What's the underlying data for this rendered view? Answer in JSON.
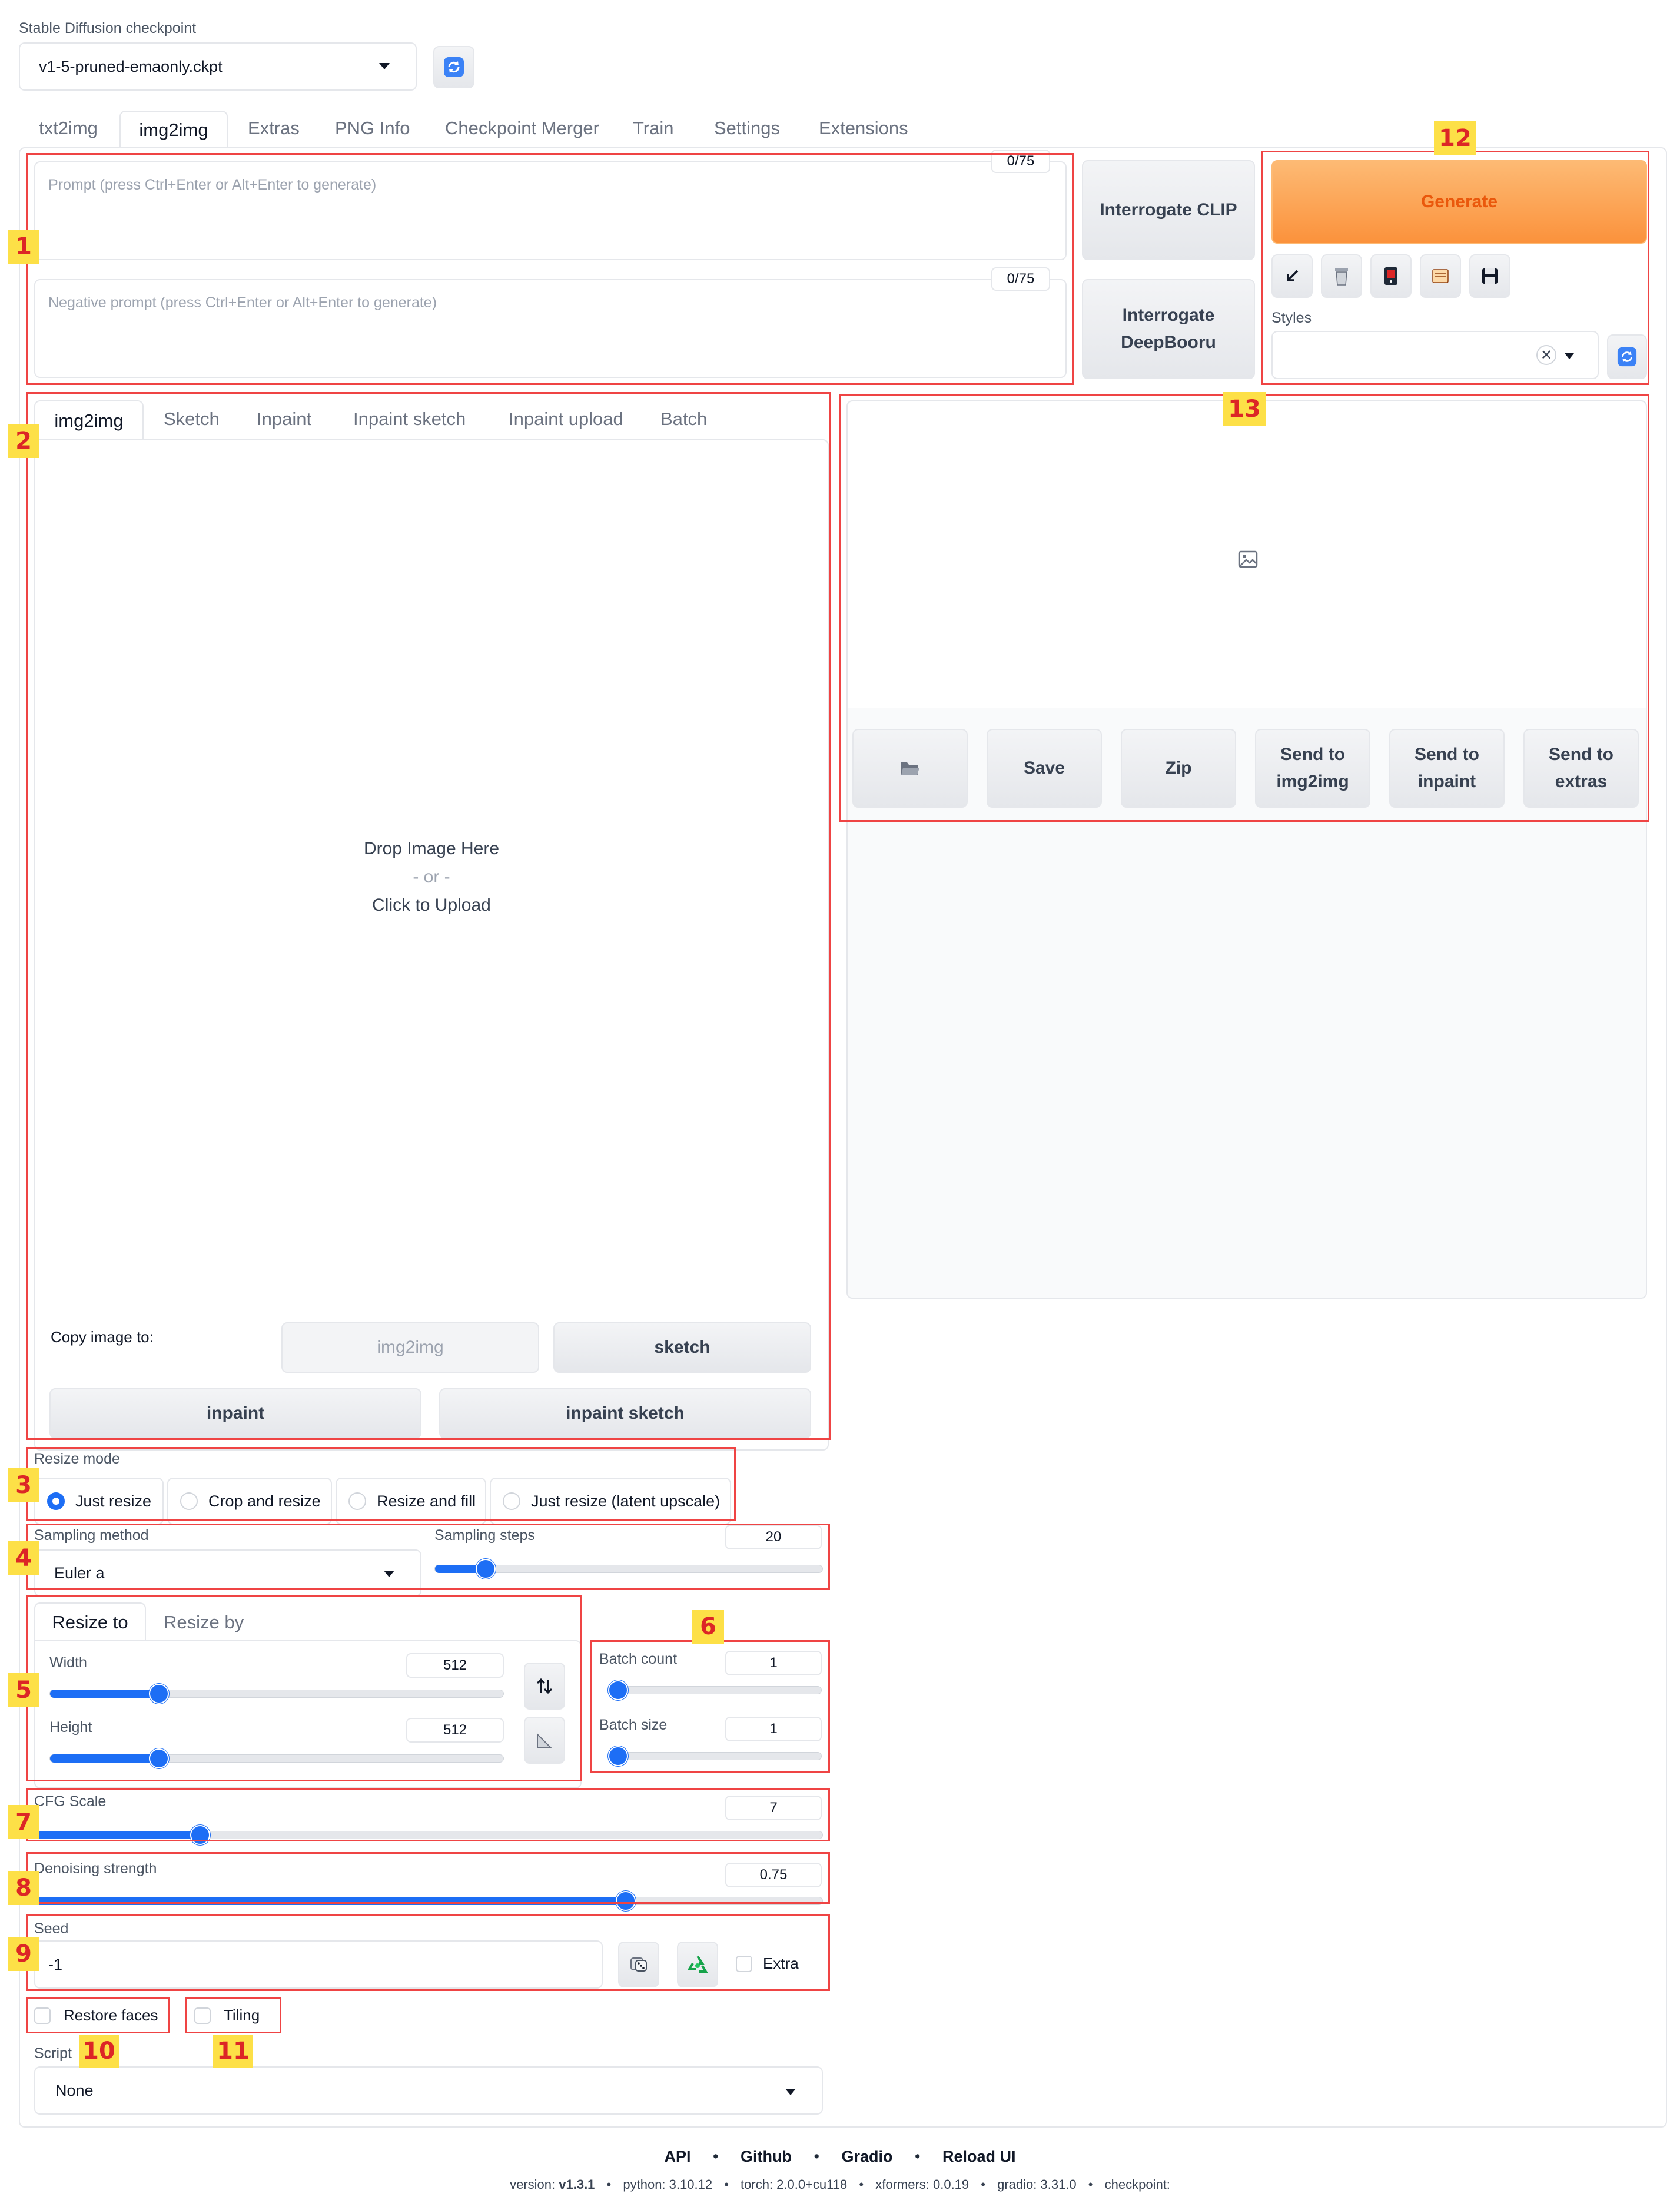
{
  "checkpoint": {
    "label": "Stable Diffusion checkpoint",
    "value": "v1-5-pruned-emaonly.ckpt"
  },
  "tabs": [
    "txt2img",
    "img2img",
    "Extras",
    "PNG Info",
    "Checkpoint Merger",
    "Train",
    "Settings",
    "Extensions"
  ],
  "active_tab": "img2img",
  "prompt": {
    "placeholder": "Prompt (press Ctrl+Enter or Alt+Enter to generate)",
    "counter": "0/75"
  },
  "negative_prompt": {
    "placeholder": "Negative prompt (press Ctrl+Enter or Alt+Enter to generate)",
    "counter": "0/75"
  },
  "interrogate": {
    "clip": "Interrogate CLIP",
    "deepbooru": "Interrogate DeepBooru"
  },
  "generate_label": "Generate",
  "styles_label": "Styles",
  "tool_icons": [
    "arrow-down-left-icon",
    "trash-icon",
    "red-card-icon",
    "clipboard-icon",
    "save-disk-icon"
  ],
  "subtabs": [
    "img2img",
    "Sketch",
    "Inpaint",
    "Inpaint sketch",
    "Inpaint upload",
    "Batch"
  ],
  "upload": {
    "line1": "Drop Image Here",
    "line2": "- or -",
    "line3": "Click to Upload"
  },
  "copy_image": {
    "label": "Copy image to:",
    "img2img": "img2img",
    "sketch": "sketch",
    "inpaint": "inpaint",
    "inpaint_sketch": "inpaint sketch"
  },
  "output_buttons": {
    "folder_icon": "folder-icon",
    "save": "Save",
    "zip": "Zip",
    "send_img2img": "Send to img2img",
    "send_inpaint": "Send to inpaint",
    "send_extras": "Send to extras"
  },
  "resize_mode": {
    "label": "Resize mode",
    "options": [
      "Just resize",
      "Crop and resize",
      "Resize and fill",
      "Just resize (latent upscale)"
    ],
    "selected": "Just resize"
  },
  "sampling": {
    "method_label": "Sampling method",
    "method": "Euler a",
    "steps_label": "Sampling steps",
    "steps": "20",
    "steps_fraction": 0.13
  },
  "resize_tabs": [
    "Resize to",
    "Resize by"
  ],
  "width": {
    "label": "Width",
    "value": "512",
    "fraction": 0.24
  },
  "height": {
    "label": "Height",
    "value": "512",
    "fraction": 0.24
  },
  "batch_count": {
    "label": "Batch count",
    "value": "1",
    "fraction": 0.0
  },
  "batch_size": {
    "label": "Batch size",
    "value": "1",
    "fraction": 0.0
  },
  "cfg": {
    "label": "CFG Scale",
    "value": "7",
    "fraction": 0.21
  },
  "denoising": {
    "label": "Denoising strength",
    "value": "0.75",
    "fraction": 0.75
  },
  "seed": {
    "label": "Seed",
    "value": "-1",
    "extra": "Extra"
  },
  "restore_faces": "Restore faces",
  "tiling": "Tiling",
  "script": {
    "label": "Script",
    "value": "None"
  },
  "badges": [
    "1",
    "2",
    "3",
    "4",
    "5",
    "6",
    "7",
    "8",
    "9",
    "10",
    "11",
    "12",
    "13"
  ],
  "footer": {
    "links": [
      "API",
      "Github",
      "Gradio",
      "Reload UI"
    ],
    "sep": "•",
    "version_label": "version:",
    "version": "v1.3.1",
    "python": "python: 3.10.12",
    "torch": "torch: 2.0.0+cu118",
    "xformers": "xformers: 0.0.19",
    "gradio": "gradio: 3.31.0",
    "checkpoint": "checkpoint:"
  },
  "colors": {
    "accent": "#1d6ef5",
    "generate_bg": "#fbbf8a",
    "generate_text": "#ea580c",
    "annotation": "#ef4444",
    "badge_bg": "#fde047"
  }
}
